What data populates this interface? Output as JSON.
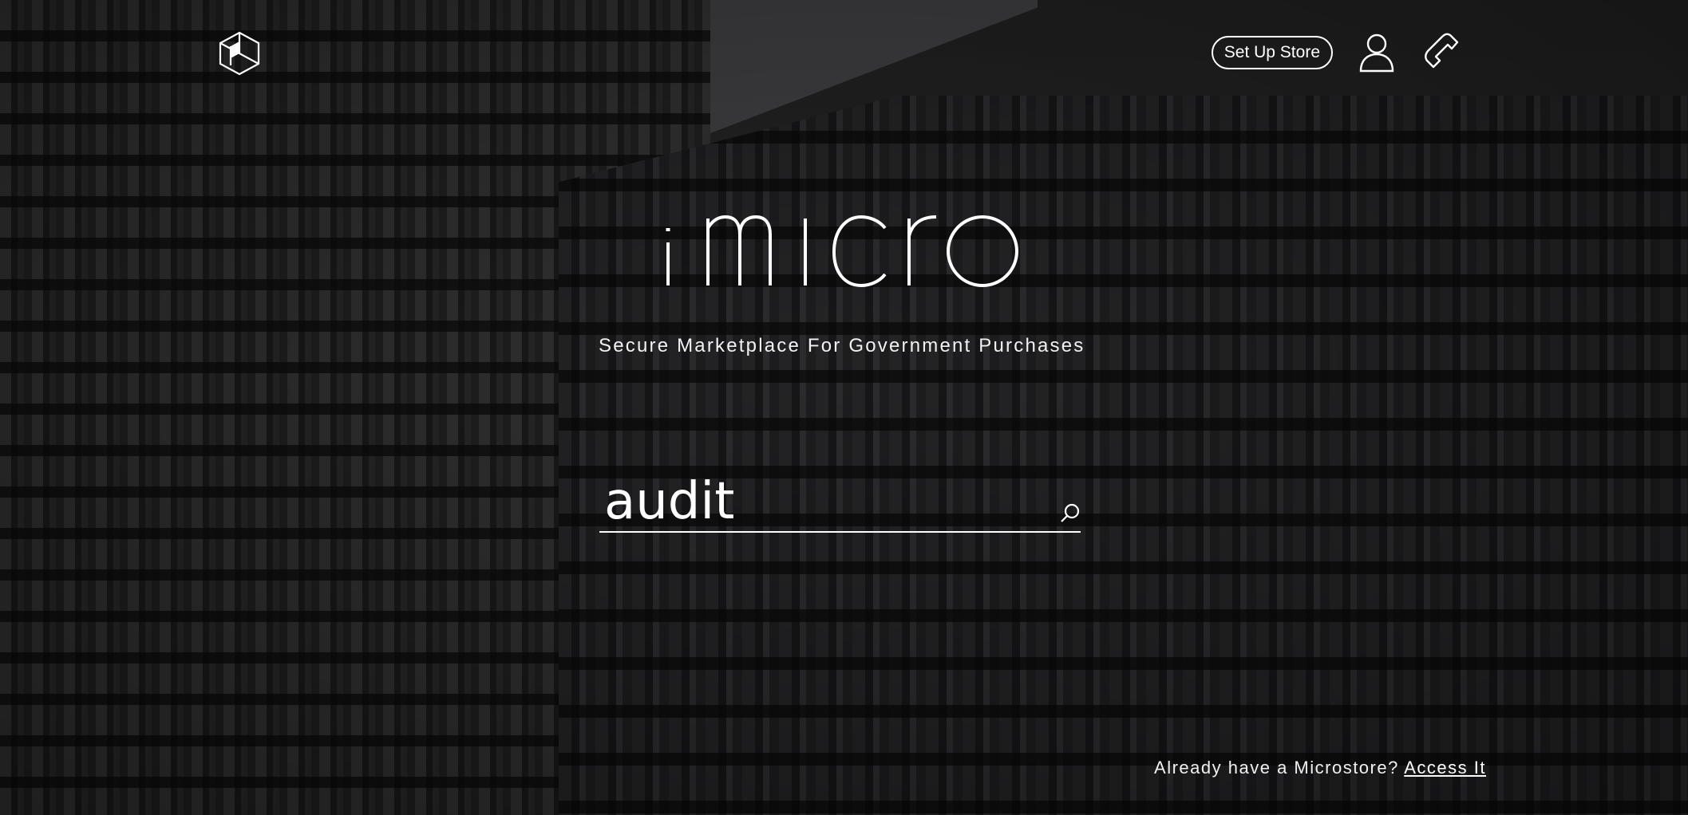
{
  "header": {
    "logo_icon": "cube-logo-icon",
    "setup_label": "Set Up Store",
    "user_icon": "user-icon",
    "phone_icon": "phone-icon"
  },
  "hero": {
    "brand": "micro",
    "tagline": "Secure Marketplace For Government Purchases"
  },
  "search": {
    "value": "audit",
    "icon": "search-icon"
  },
  "footer": {
    "prompt": "Already have a Microstore?",
    "link": "Access It"
  },
  "colors": {
    "text": "#ffffff",
    "background": "#2a2a2a"
  }
}
